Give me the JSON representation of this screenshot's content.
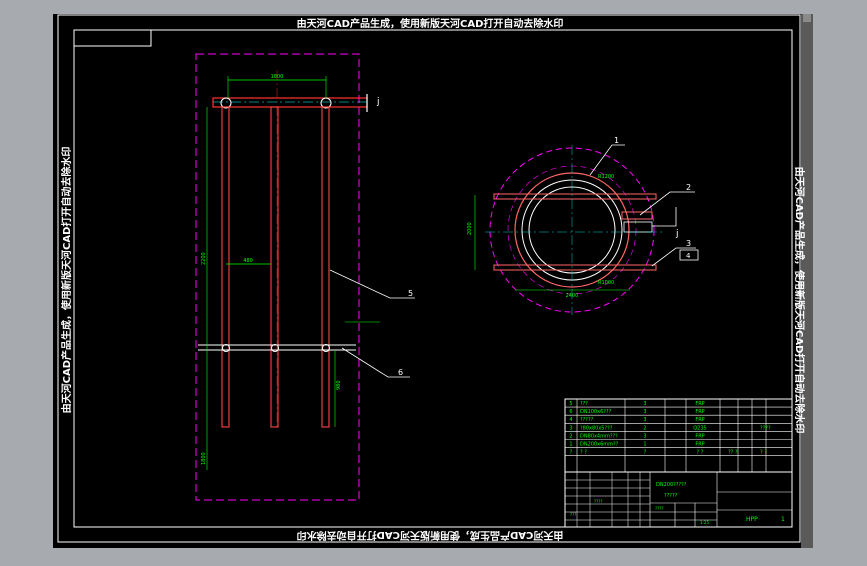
{
  "watermark": {
    "top": "由天河CAD产品生成，使用新版天河CAD打开自动去除水印",
    "bottom": "由天河CAD产品生成，使用新版天河CAD打开自动去除水印",
    "left": "由天河CAD产品生成，使用新版天河CAD打开自动去除水印",
    "right": "由天河CAD产品生成，使用新版天河CAD打开自动去除水印"
  },
  "leaders": {
    "front_5": "5",
    "front_6": "6",
    "front_j": "j",
    "plan_1": "1",
    "plan_2": "2",
    "plan_3": "3",
    "plan_4": "4",
    "plan_j": "j"
  },
  "dims": {
    "front_top": "1800",
    "front_mid": "480",
    "front_side_a": "2200",
    "front_side_b": "1800",
    "front_side_c": "980",
    "plan_left": "2000",
    "plan_bottom": "2400",
    "plan_rad": "R1200",
    "plan_inner": "R1000"
  },
  "bom": {
    "rows": [
      {
        "no": "5",
        "name": "???",
        "qty": "3",
        "mat": "FRP",
        "note": ""
      },
      {
        "no": "6",
        "name": "DN100x6???",
        "qty": "3",
        "mat": "FRP",
        "note": ""
      },
      {
        "no": "4",
        "name": "?????",
        "qty": "3",
        "mat": "FRP",
        "note": ""
      },
      {
        "no": "3",
        "name": "?80x80x5???",
        "qty": "2",
        "mat": "Q235",
        "note": "????"
      },
      {
        "no": "2",
        "name": "DN80x4mm???",
        "qty": "3",
        "mat": "FRP",
        "note": ""
      },
      {
        "no": "1",
        "name": "DN200x6mm??",
        "qty": "1",
        "mat": "FRP",
        "note": ""
      }
    ],
    "header": {
      "no": "?",
      "name": "? ?",
      "qty": "?",
      "mat": "? ?",
      "note": "? ?"
    },
    "weight": "?? ?"
  },
  "title_block": {
    "dwg_no": "DN200?????",
    "title": "?????",
    "label_a": "????",
    "label_b": "????",
    "label_c": "1:25",
    "scale": "???",
    "sheet": "HPP",
    "page": "1"
  }
}
